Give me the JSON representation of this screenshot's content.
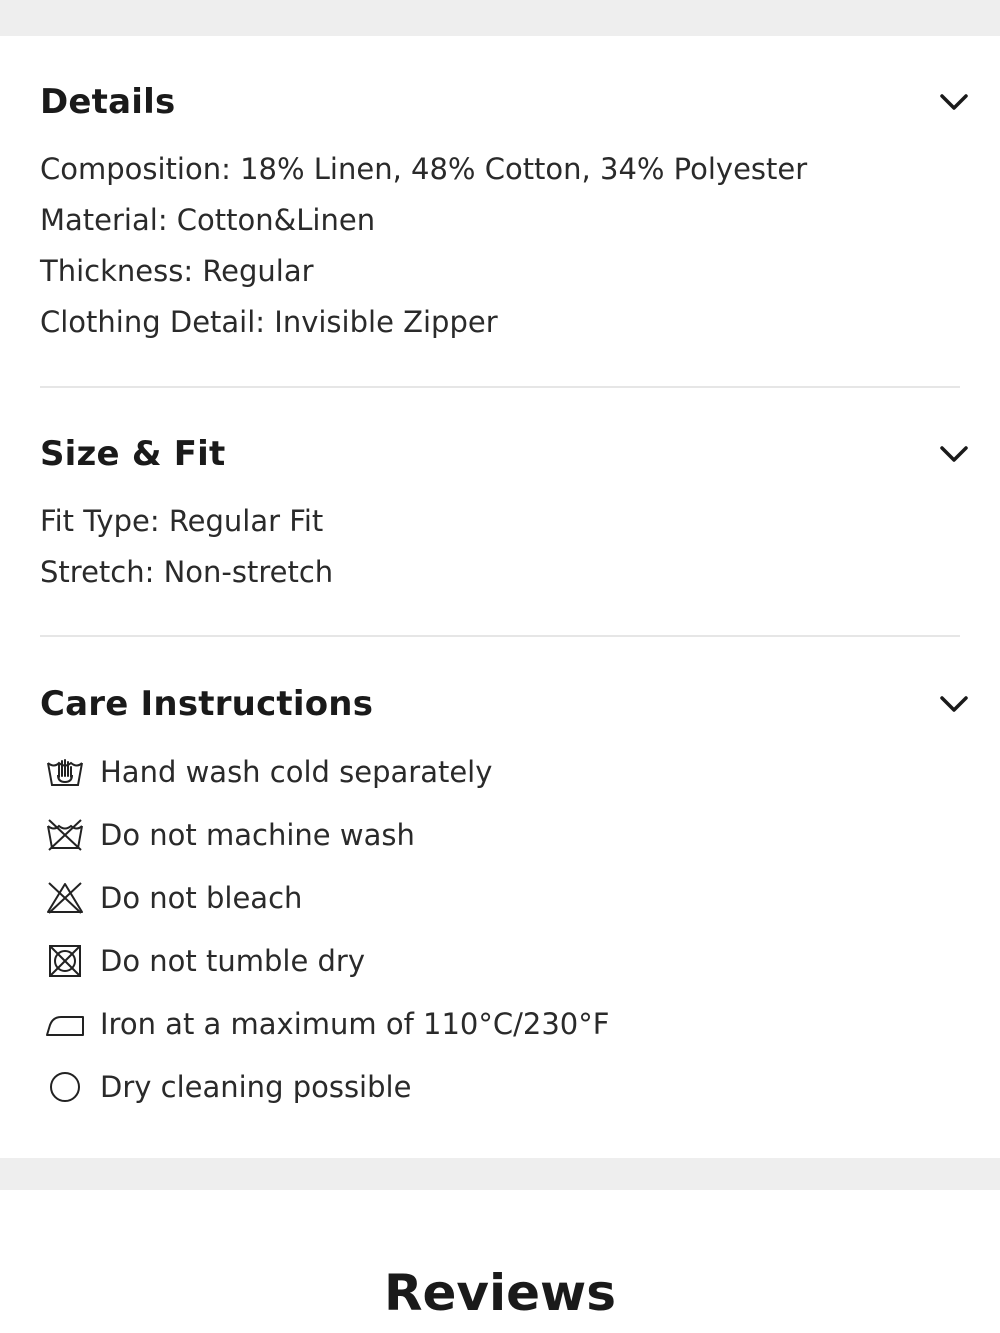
{
  "details": {
    "title": "Details",
    "lines": [
      "Composition: 18% Linen, 48% Cotton, 34% Polyester",
      "Material: Cotton&Linen",
      "Thickness: Regular",
      "Clothing Detail: Invisible Zipper"
    ]
  },
  "size_fit": {
    "title": "Size & Fit",
    "lines": [
      "Fit Type: Regular Fit",
      "Stretch: Non-stretch"
    ]
  },
  "care": {
    "title": "Care Instructions",
    "items": [
      {
        "icon": "hand-wash-icon",
        "text": "Hand wash cold separately"
      },
      {
        "icon": "no-machine-wash-icon",
        "text": "Do not machine wash"
      },
      {
        "icon": "no-bleach-icon",
        "text": "Do not bleach"
      },
      {
        "icon": "no-tumble-dry-icon",
        "text": "Do not tumble dry"
      },
      {
        "icon": "iron-icon",
        "text": "Iron at a maximum of 110°C/230°F"
      },
      {
        "icon": "dry-clean-icon",
        "text": "Dry cleaning possible"
      }
    ]
  },
  "reviews": {
    "title": "Reviews"
  },
  "icons": {
    "toggle": "chevron-down-icon"
  }
}
